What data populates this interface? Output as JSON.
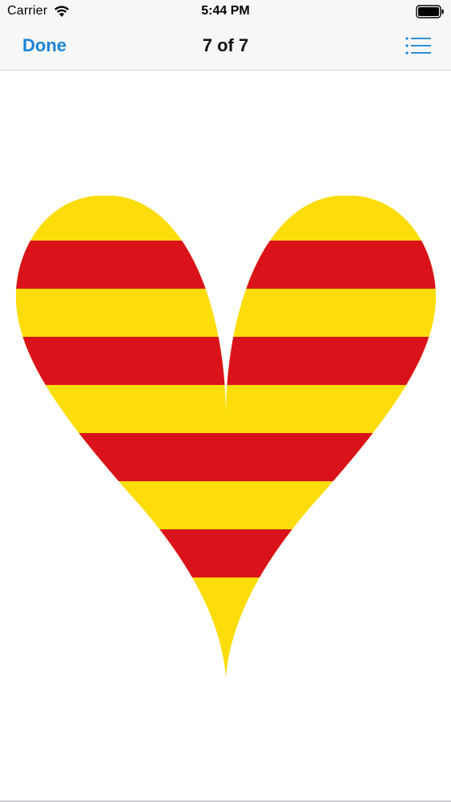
{
  "status_bar": {
    "carrier": "Carrier",
    "time": "5:44 PM",
    "wifi_icon": "wifi-icon",
    "battery_icon": "battery-full-icon"
  },
  "nav_bar": {
    "done_label": "Done",
    "title": "7 of 7",
    "list_icon": "list-icon",
    "accent_color": "#1a84d6"
  },
  "image": {
    "subject": "heart-icon",
    "colors": {
      "yellow": "#fcdd09",
      "red": "#da121a"
    }
  }
}
